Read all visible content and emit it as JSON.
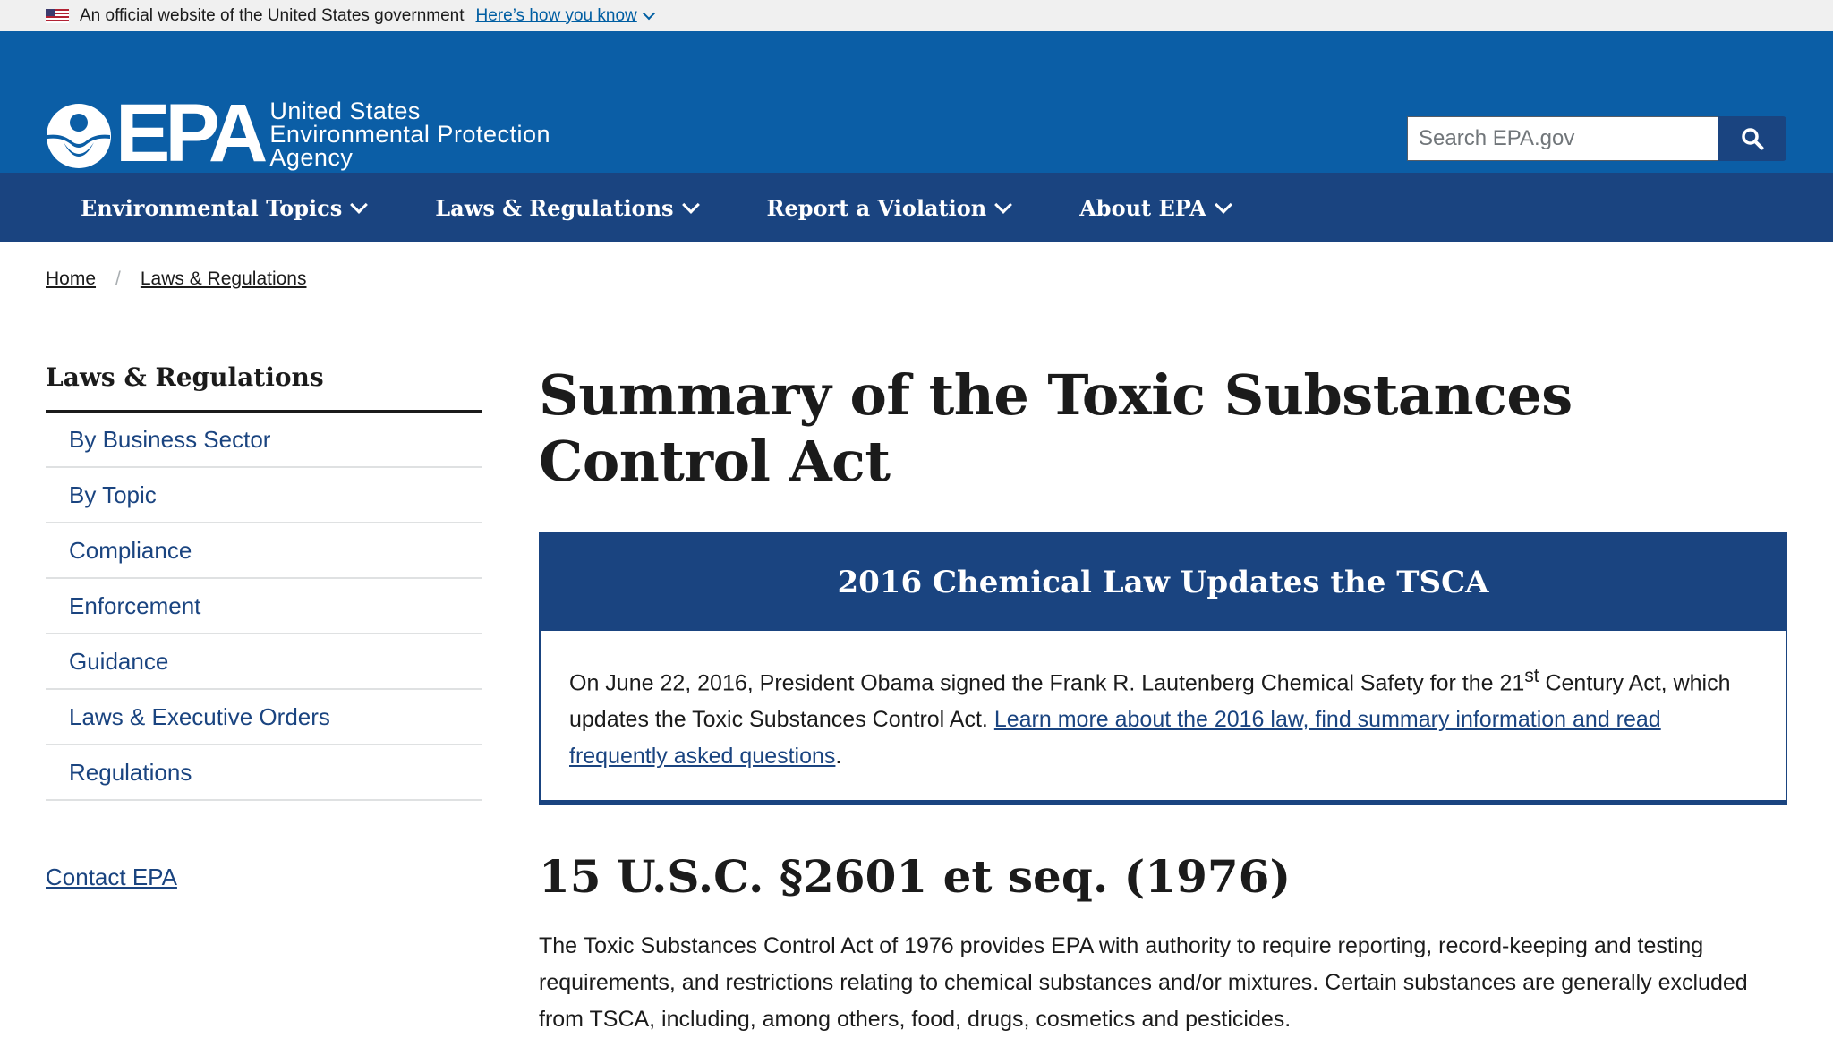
{
  "gov_banner": {
    "text": "An official website of the United States government",
    "link": "Here’s how you know"
  },
  "header": {
    "logo_letters": "EPA",
    "agency_line1": "United States",
    "agency_line2": "Environmental Protection",
    "agency_line3": "Agency",
    "search_placeholder": "Search EPA.gov",
    "colors": {
      "header_bg": "#0b5ea6",
      "nav_bg": "#1a4480"
    }
  },
  "nav": {
    "items": [
      {
        "label": "Environmental Topics"
      },
      {
        "label": "Laws & Regulations"
      },
      {
        "label": "Report a Violation"
      },
      {
        "label": "About EPA"
      }
    ]
  },
  "breadcrumb": {
    "items": [
      "Home",
      "Laws & Regulations"
    ],
    "separator": "/"
  },
  "sidebar": {
    "title": "Laws & Regulations",
    "items": [
      "By Business Sector",
      "By Topic",
      "Compliance",
      "Enforcement",
      "Guidance",
      "Laws & Executive Orders",
      "Regulations"
    ],
    "contact": "Contact EPA"
  },
  "main": {
    "title": "Summary of the Toxic Substances Control Act",
    "box": {
      "heading": "2016 Chemical Law Updates the TSCA",
      "text_before_sup": "On June 22, 2016, President Obama signed the Frank R. Lautenberg Chemical Safety for the 21",
      "sup": "st",
      "text_after_sup": " Century Act, which updates the Toxic Substances Control Act. ",
      "link": "Learn more about the 2016 law, find summary information and read frequently asked questions",
      "end": "."
    },
    "section_heading": "15 U.S.C. §2601 et seq. (1976)",
    "paragraph": "The Toxic Substances Control Act of 1976 provides EPA with authority to require reporting, record-keeping and testing requirements, and restrictions relating to chemical substances and/or mixtures. Certain substances are generally excluded from TSCA, including, among others, food, drugs, cosmetics and pesticides."
  }
}
